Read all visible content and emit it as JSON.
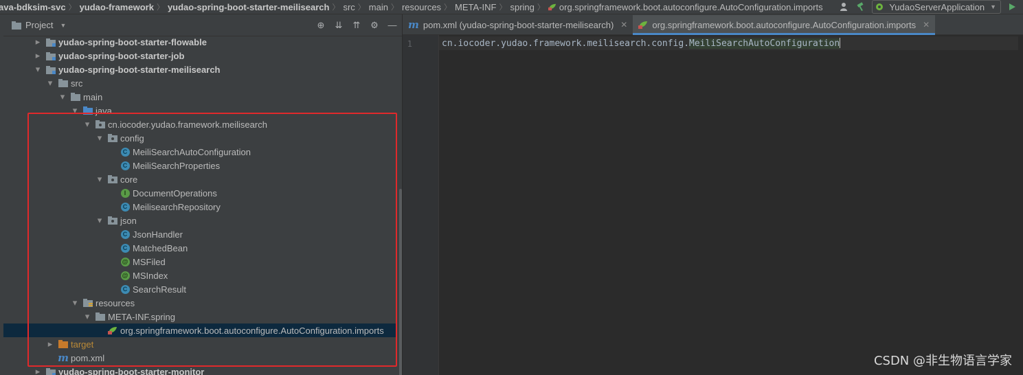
{
  "breadcrumb": [
    {
      "label": "ava-bdksim-svc",
      "bold": true
    },
    {
      "label": "yudao-framework",
      "bold": true
    },
    {
      "label": "yudao-spring-boot-starter-meilisearch",
      "bold": true
    },
    {
      "label": "src",
      "bold": false
    },
    {
      "label": "main",
      "bold": false
    },
    {
      "label": "resources",
      "bold": false
    },
    {
      "label": "META-INF",
      "bold": false
    },
    {
      "label": "spring",
      "bold": false
    }
  ],
  "breadcrumb_leaf": "org.springframework.boot.autoconfigure.AutoConfiguration.imports",
  "run_config": "YudaoServerApplication",
  "project_panel": {
    "title": "Project",
    "tree": [
      {
        "label": "yudao-spring-boot-starter-flowable",
        "level": 2,
        "arrow": "collapsed",
        "icon": "module-folder-icon",
        "bold": true
      },
      {
        "label": "yudao-spring-boot-starter-job",
        "level": 2,
        "arrow": "collapsed",
        "icon": "module-folder-icon",
        "bold": true
      },
      {
        "label": "yudao-spring-boot-starter-meilisearch",
        "level": 2,
        "arrow": "expanded",
        "icon": "module-folder-icon",
        "bold": true
      },
      {
        "label": "src",
        "level": 3,
        "arrow": "expanded",
        "icon": "folder-icon"
      },
      {
        "label": "main",
        "level": 4,
        "arrow": "expanded",
        "icon": "folder-icon"
      },
      {
        "label": "java",
        "level": 5,
        "arrow": "expanded",
        "icon": "source-folder-icon"
      },
      {
        "label": "cn.iocoder.yudao.framework.meilisearch",
        "level": 6,
        "arrow": "expanded",
        "icon": "package-icon"
      },
      {
        "label": "config",
        "level": 7,
        "arrow": "expanded",
        "icon": "package-icon"
      },
      {
        "label": "MeiliSearchAutoConfiguration",
        "level": 8,
        "arrow": "none",
        "icon": "class-icon"
      },
      {
        "label": "MeiliSearchProperties",
        "level": 8,
        "arrow": "none",
        "icon": "class-icon"
      },
      {
        "label": "core",
        "level": 7,
        "arrow": "expanded",
        "icon": "package-icon"
      },
      {
        "label": "DocumentOperations",
        "level": 8,
        "arrow": "none",
        "icon": "interface-icon"
      },
      {
        "label": "MeilisearchRepository",
        "level": 8,
        "arrow": "none",
        "icon": "class-icon"
      },
      {
        "label": "json",
        "level": 7,
        "arrow": "expanded",
        "icon": "package-icon"
      },
      {
        "label": "JsonHandler",
        "level": 8,
        "arrow": "none",
        "icon": "class-icon"
      },
      {
        "label": "MatchedBean",
        "level": 8,
        "arrow": "none",
        "icon": "class-icon"
      },
      {
        "label": "MSFiled",
        "level": 8,
        "arrow": "none",
        "icon": "annotation-icon"
      },
      {
        "label": "MSIndex",
        "level": 8,
        "arrow": "none",
        "icon": "annotation-icon"
      },
      {
        "label": "SearchResult",
        "level": 8,
        "arrow": "none",
        "icon": "class-icon"
      },
      {
        "label": "resources",
        "level": 5,
        "arrow": "expanded",
        "icon": "resources-folder-icon"
      },
      {
        "label": "META-INF.spring",
        "level": 6,
        "arrow": "expanded",
        "icon": "folder-icon"
      },
      {
        "label": "org.springframework.boot.autoconfigure.AutoConfiguration.imports",
        "level": 7,
        "arrow": "none",
        "icon": "spring-file-icon",
        "selected": true
      },
      {
        "label": "target",
        "level": 3,
        "arrow": "collapsed",
        "icon": "excluded-folder-icon",
        "target": true
      },
      {
        "label": "pom.xml",
        "level": 3,
        "arrow": "none",
        "icon": "maven-icon"
      },
      {
        "label": "yudao-spring-boot-starter-monitor",
        "level": 2,
        "arrow": "collapsed",
        "icon": "module-folder-icon",
        "bold": true
      }
    ]
  },
  "editor": {
    "tabs": [
      {
        "label": "pom.xml (yudao-spring-boot-starter-meilisearch)",
        "icon": "maven-icon",
        "active": false
      },
      {
        "label": "org.springframework.boot.autoconfigure.AutoConfiguration.imports",
        "icon": "spring-file-icon",
        "active": true
      }
    ],
    "line_number": "1",
    "code_prefix": "cn.iocoder.yudao.framework.meilisearch.config.",
    "code_highlight": "MeiliSearchAutoConfiguration"
  },
  "watermark": "CSDN @非生物语言学家",
  "colors": {
    "highlight_box": "#e0292b",
    "selection": "#0d293e",
    "class_icon": "#3d8bb3",
    "interface_icon": "#5a9b47"
  }
}
